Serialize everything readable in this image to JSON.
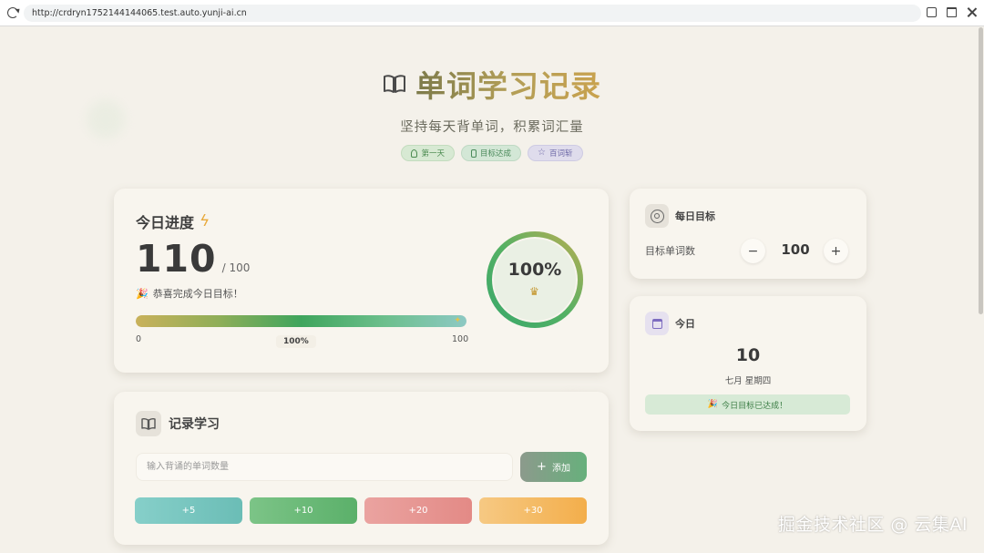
{
  "browser": {
    "url": "http://crdryn1752144144065.test.auto.yunji-ai.cn"
  },
  "header": {
    "title": "单词学习记录",
    "subtitle": "坚持每天背单词，积累词汇量",
    "badges": [
      {
        "label": "第一天",
        "icon": "award-icon"
      },
      {
        "label": "目标达成",
        "icon": "medal-icon"
      },
      {
        "label": "百词斩",
        "icon": "star-icon"
      }
    ]
  },
  "progress": {
    "title": "今日进度",
    "count": "110",
    "total": "/ 100",
    "congrats": "恭喜完成今日目标！",
    "bar_fraction": 1.0,
    "bar_min": "0",
    "bar_max": "100",
    "bar_percent": "100%",
    "ring_percent": "100%",
    "ring_fraction": 1.0
  },
  "record": {
    "title": "记录学习",
    "input_placeholder": "输入背诵的单词数量",
    "input_value": "",
    "add_label": "添加",
    "quick_buttons": [
      "+5",
      "+10",
      "+20",
      "+30"
    ]
  },
  "goal": {
    "title": "每日目标",
    "label": "目标单词数",
    "minus": "−",
    "value": "100",
    "plus": "+"
  },
  "today": {
    "title": "今日",
    "day": "10",
    "date": "七月 星期四",
    "status": "今日目标已达成！"
  },
  "watermark": "掘金技术社区 @ 云集AI",
  "colors": {
    "accent_gold": "#c9a24e",
    "accent_green": "#3fa55d",
    "status_green_bg": "#d7ead6"
  }
}
